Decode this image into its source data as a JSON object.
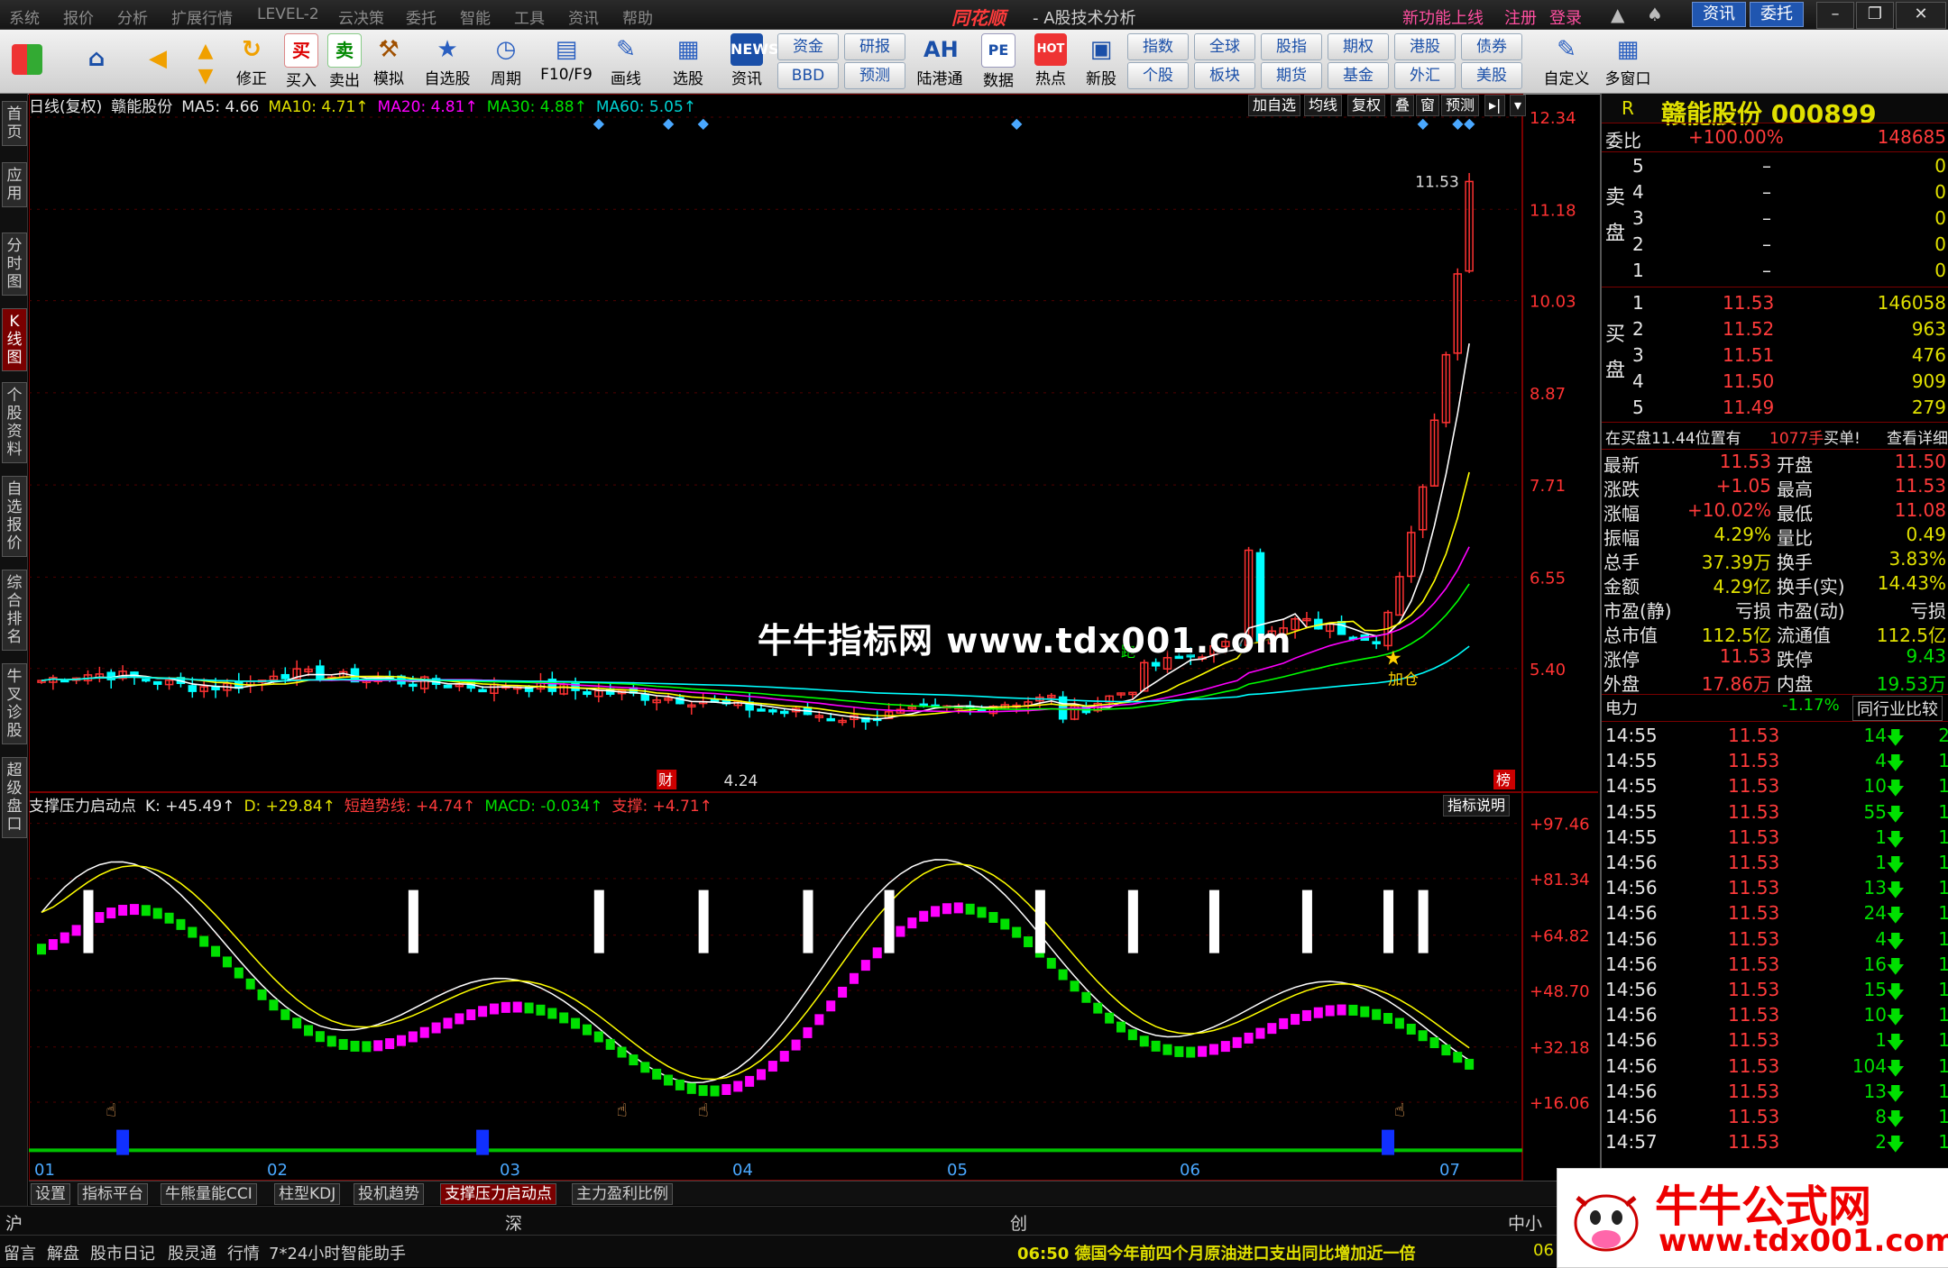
{
  "menubar": {
    "items": [
      "系统",
      "报价",
      "分析",
      "扩展行情",
      "LEVEL-2",
      "云决策",
      "委托",
      "智能",
      "工具",
      "资讯",
      "帮助"
    ],
    "app_name": "同花顺",
    "app_subtitle": "- A股技术分析",
    "links": [
      "新功能上线",
      "注册",
      "登录"
    ],
    "news_btn": "资讯",
    "trade_btn": "委托"
  },
  "toolbar": {
    "buttons": [
      "修正",
      "买入",
      "卖出",
      "模拟",
      "自选股",
      "周期",
      "F10/F9",
      "画线",
      "选股",
      "资讯",
      "陆港通",
      "数据",
      "热点",
      "新股"
    ],
    "news_icon": "NEWS",
    "grid_top": [
      "资金",
      "研报",
      "指数",
      "全球",
      "股指",
      "期权",
      "港股",
      "债券"
    ],
    "grid_bottom": [
      "BBD",
      "预测",
      "个股",
      "板块",
      "期货",
      "基金",
      "外汇",
      "美股"
    ],
    "ah_label": "AH",
    "pe_label": "PE",
    "hot_label": "HOT",
    "custom": "自定义",
    "multiwin": "多窗口"
  },
  "left_tabs": [
    "首页",
    "应用",
    "分时图",
    "K线图",
    "个股资料",
    "自选报价",
    "综合排名",
    "牛叉诊股",
    "超级盘口"
  ],
  "chart_header": {
    "title": "日线(复权)",
    "stock": "赣能股份",
    "ma5": "MA5: 4.66",
    "ma10": "MA10: 4.71↑",
    "ma20": "MA20: 4.81↑",
    "ma30": "MA30: 4.88↑",
    "ma60": "MA60: 5.05↑",
    "buttons": [
      "加自选",
      "均线",
      "复权",
      "叠",
      "窗",
      "预测"
    ]
  },
  "indicator_header": {
    "name": "支撑压力启动点",
    "k": "K: +45.49↑",
    "d": "D: +29.84↑",
    "short": "短趋势线: +4.74↑",
    "macd": "MACD: -0.034↑",
    "support": "支撑: +4.71↑",
    "help_btn": "指标说明"
  },
  "bottom_tabs": [
    "设置",
    "指标平台",
    "牛熊量能CCI",
    "柱型KDJ",
    "投机趋势",
    "支撑压力启动点",
    "主力盈利比例"
  ],
  "index_row": {
    "sh": "沪",
    "sz": "深",
    "cy": "创",
    "zx": "中小"
  },
  "status_row": {
    "items": [
      "留言",
      "解盘",
      "股市日记",
      "股灵通",
      "行情",
      "7*24小时",
      "智能助手"
    ],
    "news": "06:50 德国今年前四个月原油进口支出同比增加近一倍",
    "time": "06"
  },
  "watermarks": {
    "center": "牛牛指标网 www.tdx001.com",
    "corner_title": "牛牛公式网",
    "corner_url": "www.tdx001.com"
  },
  "annotations": {
    "high_label": "11.53",
    "low_label": "4.24",
    "add_label": "加仓",
    "wealth": "财",
    "rank": "榜",
    "run": "跑"
  },
  "right_panel": {
    "r_label": "R",
    "name": "赣能股份 000899",
    "weibi_label": "委比",
    "weibi_val": "+100.00%",
    "weibi_num": "148685",
    "sell_label": "卖盘",
    "buy_label": "买盘",
    "sell": [
      {
        "lv": "5",
        "price": "–",
        "vol": "0"
      },
      {
        "lv": "4",
        "price": "–",
        "vol": "0"
      },
      {
        "lv": "3",
        "price": "–",
        "vol": "0"
      },
      {
        "lv": "2",
        "price": "–",
        "vol": "0"
      },
      {
        "lv": "1",
        "price": "–",
        "vol": "0"
      }
    ],
    "buy": [
      {
        "lv": "1",
        "price": "11.53",
        "vol": "146058"
      },
      {
        "lv": "2",
        "price": "11.52",
        "vol": "963"
      },
      {
        "lv": "3",
        "price": "11.51",
        "vol": "476"
      },
      {
        "lv": "4",
        "price": "11.50",
        "vol": "909"
      },
      {
        "lv": "5",
        "price": "11.49",
        "vol": "279"
      }
    ],
    "notice": "在买盘11.44位置有",
    "notice_vol": "1077手",
    "notice_act": "买单!",
    "notice_link": "查看详细",
    "stats": [
      {
        "l1": "最新",
        "v1": "11.53",
        "l2": "开盘",
        "v2": "11.50"
      },
      {
        "l1": "涨跌",
        "v1": "+1.05",
        "l2": "最高",
        "v2": "11.53"
      },
      {
        "l1": "涨幅",
        "v1": "+10.02%",
        "l2": "最低",
        "v2": "11.08"
      },
      {
        "l1": "振幅",
        "v1": "4.29%",
        "l2": "量比",
        "v2": "0.49"
      },
      {
        "l1": "总手",
        "v1": "37.39万",
        "l2": "换手",
        "v2": "3.83%"
      },
      {
        "l1": "金额",
        "v1": "4.29亿",
        "l2": "换手(实)",
        "v2": "14.43%"
      },
      {
        "l1": "市盈(静)",
        "v1": "亏损",
        "l2": "市盈(动)",
        "v2": "亏损"
      },
      {
        "l1": "总市值",
        "v1": "112.5亿",
        "l2": "流通值",
        "v2": "112.5亿"
      },
      {
        "l1": "涨停",
        "v1": "11.53",
        "l2": "跌停",
        "v2": "9.43"
      },
      {
        "l1": "外盘",
        "v1": "17.86万",
        "l2": "内盘",
        "v2": "19.53万"
      }
    ],
    "sector": "电力",
    "sector_chg": "-1.17%",
    "sector_btn": "同行业比较",
    "ticks": [
      {
        "t": "14:55",
        "p": "11.53",
        "v": "14",
        "x": "2"
      },
      {
        "t": "14:55",
        "p": "11.53",
        "v": "4",
        "x": "1"
      },
      {
        "t": "14:55",
        "p": "11.53",
        "v": "10",
        "x": "1"
      },
      {
        "t": "14:55",
        "p": "11.53",
        "v": "55",
        "x": "1"
      },
      {
        "t": "14:55",
        "p": "11.53",
        "v": "1",
        "x": "1"
      },
      {
        "t": "14:56",
        "p": "11.53",
        "v": "1",
        "x": "1"
      },
      {
        "t": "14:56",
        "p": "11.53",
        "v": "13",
        "x": "1"
      },
      {
        "t": "14:56",
        "p": "11.53",
        "v": "24",
        "x": "1"
      },
      {
        "t": "14:56",
        "p": "11.53",
        "v": "4",
        "x": "1"
      },
      {
        "t": "14:56",
        "p": "11.53",
        "v": "16",
        "x": "1"
      },
      {
        "t": "14:56",
        "p": "11.53",
        "v": "15",
        "x": "1"
      },
      {
        "t": "14:56",
        "p": "11.53",
        "v": "10",
        "x": "1"
      },
      {
        "t": "14:56",
        "p": "11.53",
        "v": "1",
        "x": "1"
      },
      {
        "t": "14:56",
        "p": "11.53",
        "v": "104",
        "x": "1"
      },
      {
        "t": "14:56",
        "p": "11.53",
        "v": "13",
        "x": "1"
      },
      {
        "t": "14:56",
        "p": "11.53",
        "v": "8",
        "x": "1"
      },
      {
        "t": "14:57",
        "p": "11.53",
        "v": "2",
        "x": "1"
      }
    ]
  },
  "chart_data": {
    "type": "candlestick",
    "price_axis": [
      "12.34",
      "11.18",
      "10.03",
      "8.87",
      "7.71",
      "6.55",
      "5.40"
    ],
    "indicator_axis": [
      "+97.46",
      "+81.34",
      "+64.82",
      "+48.70",
      "+32.18",
      "+16.06"
    ],
    "month_labels": [
      "01",
      "02",
      "03",
      "04",
      "05",
      "06",
      "07"
    ],
    "price_range": [
      3.9,
      12.34
    ],
    "indicator_range": [
      0,
      100
    ]
  },
  "colors": {
    "up": "#ff3232",
    "down": "#00ffff",
    "ma5": "#ffffff",
    "ma10": "#ffff00",
    "ma20": "#ff00ff",
    "ma30": "#00ff00",
    "ma60": "#00ffff",
    "panel_red": "#ff3b3b",
    "panel_yellow": "#e0e000"
  }
}
